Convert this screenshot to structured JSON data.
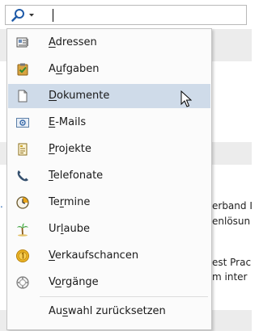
{
  "search": {
    "value": "",
    "icon": "search-icon",
    "dropdown_icon": "chevron-down-icon"
  },
  "background": {
    "fragments": [
      "erband I",
      "enlösun",
      "est Prac",
      "m inter"
    ]
  },
  "menu": {
    "items": [
      {
        "label": "Adressen",
        "icon": "address-book-icon"
      },
      {
        "label": "Aufgaben",
        "icon": "task-icon"
      },
      {
        "label": "Dokumente",
        "icon": "document-icon"
      },
      {
        "label": "E-Mails",
        "icon": "email-icon"
      },
      {
        "label": "Projekte",
        "icon": "project-icon"
      },
      {
        "label": "Telefonate",
        "icon": "phone-icon"
      },
      {
        "label": "Termine",
        "icon": "appointment-icon"
      },
      {
        "label": "Urlaube",
        "icon": "vacation-icon"
      },
      {
        "label": "Verkaufschancen",
        "icon": "sales-opportunity-icon"
      },
      {
        "label": "Vorgänge",
        "icon": "process-icon"
      }
    ],
    "hovered_index": 2,
    "reset_label": "Auswahl zurücksetzen"
  },
  "colors": {
    "hover": "#cfdbe9",
    "menu_background": "#fbfbfb",
    "search_icon": "#1e5aa8"
  }
}
